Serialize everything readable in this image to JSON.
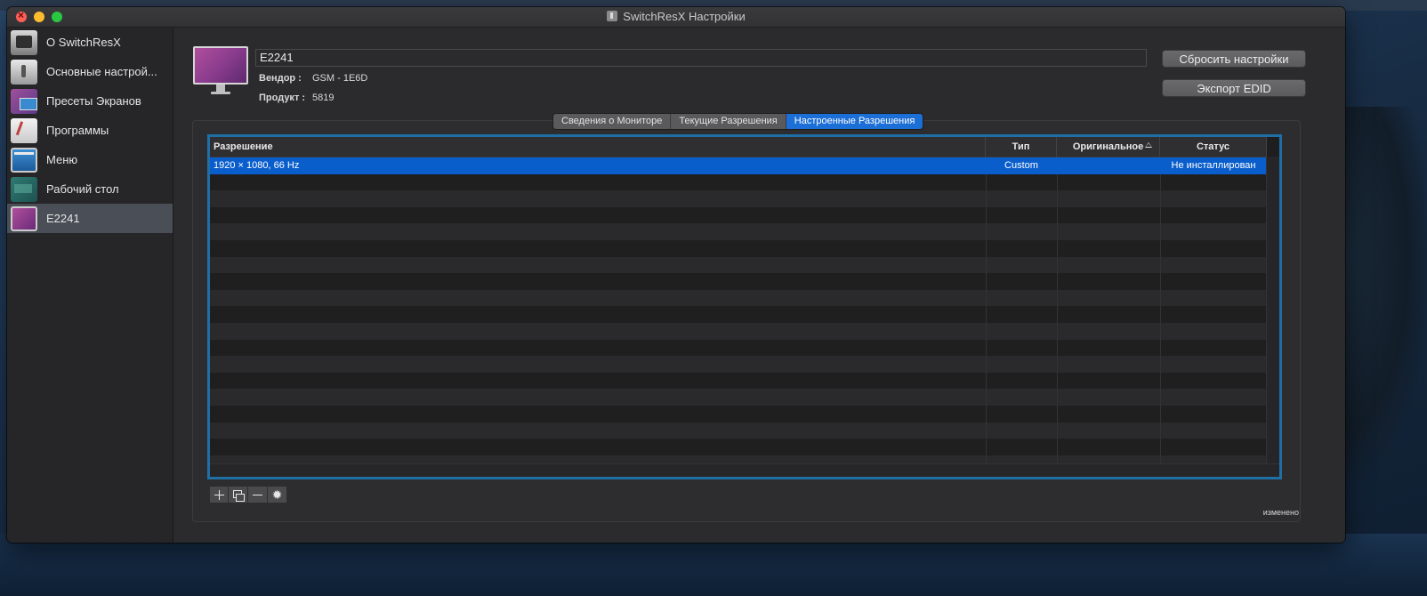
{
  "window": {
    "title": "SwitchResX Настройки"
  },
  "sidebar": {
    "items": [
      {
        "label": "О SwitchResX",
        "icon": "about-icon"
      },
      {
        "label": "Основные настрой...",
        "icon": "settings-icon"
      },
      {
        "label": "Пресеты Экранов",
        "icon": "display-presets-icon"
      },
      {
        "label": "Программы",
        "icon": "programs-icon"
      },
      {
        "label": "Меню",
        "icon": "menu-icon"
      },
      {
        "label": "Рабочий стол",
        "icon": "desktop-icon"
      },
      {
        "label": "E2241",
        "icon": "display-icon",
        "selected": true
      }
    ]
  },
  "display": {
    "name": "E2241",
    "vendor_label": "Вендор :",
    "vendor_value": "GSM - 1E6D",
    "product_label": "Продукт :",
    "product_value": "5819"
  },
  "buttons": {
    "reset": "Сбросить настройки",
    "export": "Экспорт EDID"
  },
  "tabs": [
    {
      "label": "Сведения о Мониторе",
      "active": false
    },
    {
      "label": "Текущие Разрешения",
      "active": false
    },
    {
      "label": "Настроенные Разрешения",
      "active": true
    }
  ],
  "table": {
    "columns": [
      "Разрешение",
      "Тип",
      "Оригинальное",
      "Статус"
    ],
    "rows": [
      {
        "resolution": "1920 × 1080, 66 Hz",
        "type": "Custom",
        "original": "",
        "status": "Не инсталлирован"
      }
    ]
  },
  "tools": [
    "add-icon",
    "duplicate-icon",
    "remove-icon",
    "gear-icon"
  ],
  "status_note": "изменено"
}
